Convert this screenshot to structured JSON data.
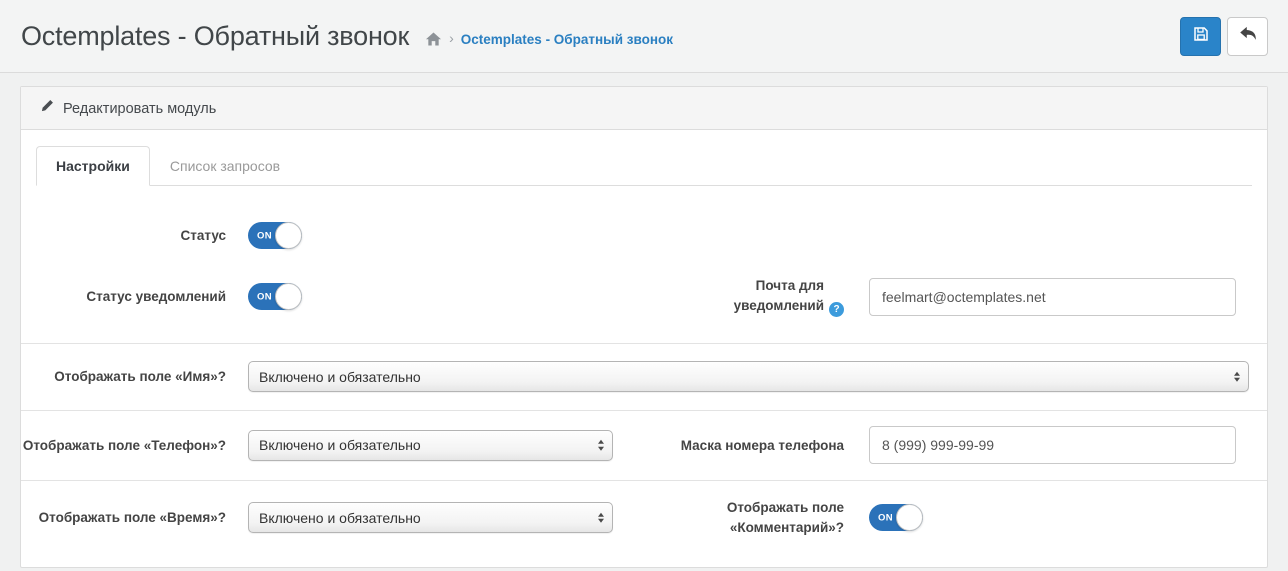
{
  "header": {
    "title": "Octemplates - Обратный звонок",
    "breadcrumb_separator": "›",
    "breadcrumb_current": "Octemplates - Обратный звонок"
  },
  "panel": {
    "heading": "Редактировать модуль",
    "tabs": [
      {
        "label": "Настройки"
      },
      {
        "label": "Список запросов"
      }
    ]
  },
  "form": {
    "status": {
      "label": "Статус",
      "state": "ON"
    },
    "notify_status": {
      "label": "Статус уведомлений",
      "state": "ON"
    },
    "notify_email": {
      "label": "Почта для уведомлений",
      "help_glyph": "?",
      "value": "feelmart@octemplates.net"
    },
    "show_name": {
      "label": "Отображать поле «Имя»?",
      "value": "Включено и обязательно"
    },
    "show_phone": {
      "label": "Отображать поле «Телефон»?",
      "value": "Включено и обязательно"
    },
    "phone_mask": {
      "label": "Маска номера телефона",
      "value": "8 (999) 999-99-99"
    },
    "show_time": {
      "label": "Отображать поле «Время»?",
      "value": "Включено и обязательно"
    },
    "show_comment": {
      "label": "Отображать поле «Комментарий»?",
      "state": "ON"
    }
  },
  "colors": {
    "accent_blue": "#2a84c9",
    "toggle_blue": "#2b72b9",
    "link_blue": "#2a7fc1"
  }
}
